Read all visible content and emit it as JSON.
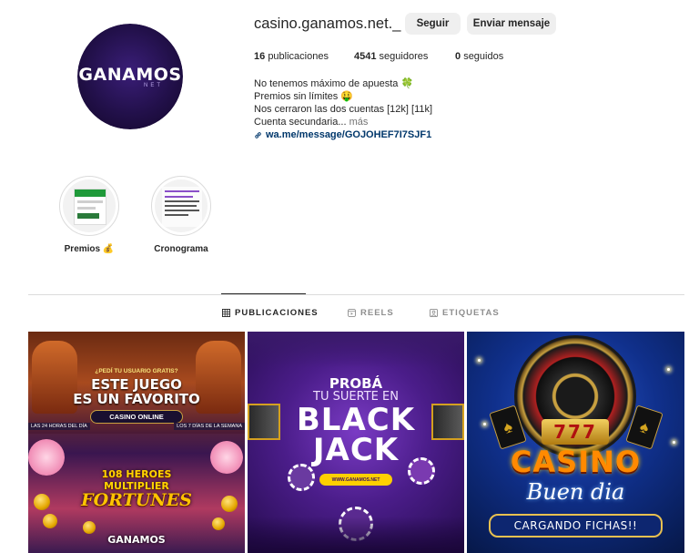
{
  "profile": {
    "username": "casino.ganamos.net._",
    "avatar_logo": "GANAMOS",
    "avatar_logo_sub": "NET",
    "follow_label": "Seguir",
    "message_label": "Enviar mensaje",
    "stats": {
      "posts_count": "16",
      "posts_label": "publicaciones",
      "followers_count": "4541",
      "followers_label": "seguidores",
      "following_count": "0",
      "following_label": "seguidos"
    },
    "bio": {
      "line1": "No tenemos máximo de apuesta",
      "line1_emoji": "🍀",
      "line2": "Premios sin límites",
      "line2_emoji": "🤑",
      "line3": "Nos cerraron las dos cuentas [12k] [11k]",
      "line4": "Cuenta secundaria...",
      "more": "más",
      "link": "wa.me/message/GOJOHEF7I7SJF1"
    }
  },
  "highlights": [
    {
      "label": "Premios",
      "emoji": "💰"
    },
    {
      "label": "Cronograma",
      "emoji": ""
    }
  ],
  "tabs": [
    {
      "label": "PUBLICACIONES",
      "icon": "grid-icon",
      "active": true
    },
    {
      "label": "REELS",
      "icon": "reels-icon",
      "active": false
    },
    {
      "label": "ETIQUETAS",
      "icon": "tagged-icon",
      "active": false
    }
  ],
  "posts": [
    {
      "small": "¿PEDÍ TU USUARIO GRATIS?",
      "title_line1": "ESTE JUEGO",
      "title_line2": "ES UN FAVORITO",
      "badge": "CASINO ONLINE",
      "side_left": "LAS 24 HORAS DEL DÍA",
      "side_right": "LOS 7 DÍAS DE LA SEMANA",
      "game_line1": "108 HEROES",
      "game_line2": "MULTIPLIER",
      "game_line3": "FORTUNES",
      "logo": "GANAMOS"
    },
    {
      "line1": "PROBÁ",
      "line2": "TU SUERTE EN",
      "line3": "BLACK",
      "line4": "JACK",
      "pill": "WWW.GANAMOS.NET"
    },
    {
      "slot": "777",
      "title": "CASINO",
      "subtitle": "Buen dia",
      "button": "CARGANDO FICHAS!!"
    }
  ],
  "colors": {
    "link": "#00376b",
    "secondary_text": "#737373",
    "button_bg": "#efefef",
    "divider": "#dbdbdb"
  }
}
